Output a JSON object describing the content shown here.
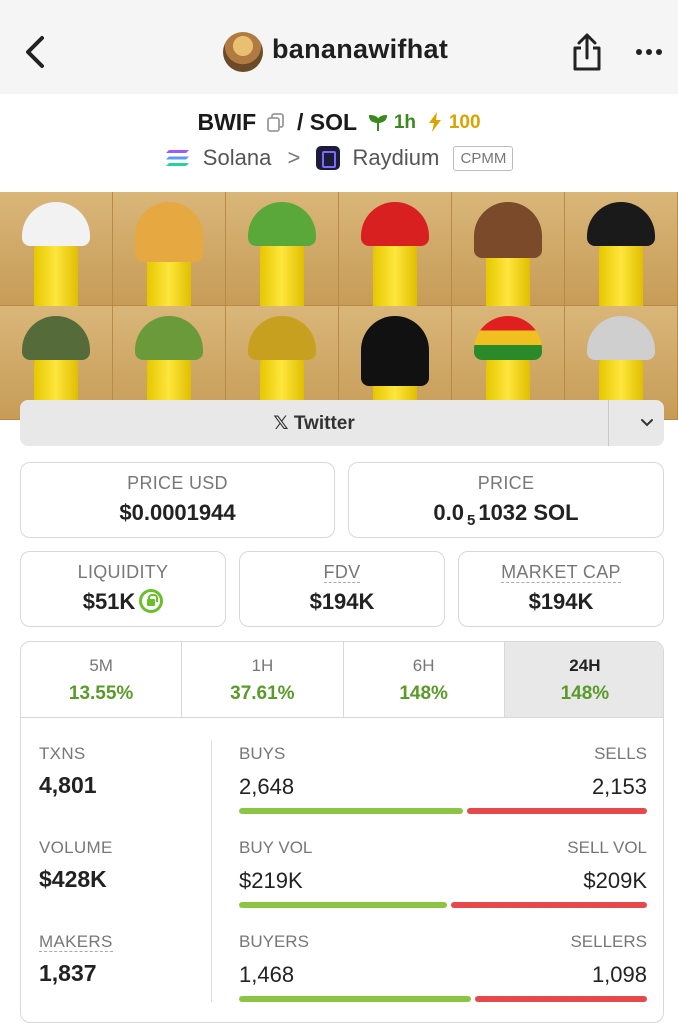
{
  "header": {
    "title": "bananawifhat",
    "back_icon": "chevron-left-icon",
    "share_icon": "share-icon",
    "more_icon": "more-icon"
  },
  "pair": {
    "base": "BWIF",
    "separator": "/",
    "quote": "SOL",
    "age": "1h",
    "boost": "100"
  },
  "chain": {
    "network": "Solana",
    "arrow": ">",
    "dex": "Raydium",
    "pool_type": "CPMM"
  },
  "social": {
    "label": "Twitter",
    "icon": "x-icon"
  },
  "stats": {
    "price_usd_label": "PRICE USD",
    "price_usd": "$0.0001944",
    "price_label": "PRICE",
    "price_prefix": "0.0",
    "price_sub": "5",
    "price_rest": "1032 SOL",
    "liquidity_label": "LIQUIDITY",
    "liquidity": "$51K",
    "fdv_label": "FDV",
    "fdv": "$194K",
    "mcap_label": "MARKET CAP",
    "mcap": "$194K"
  },
  "tabs": [
    {
      "label": "5M",
      "value": "13.55%"
    },
    {
      "label": "1H",
      "value": "37.61%"
    },
    {
      "label": "6H",
      "value": "148%"
    },
    {
      "label": "24H",
      "value": "148%"
    }
  ],
  "details": {
    "txns_label": "TXNS",
    "txns": "4,801",
    "volume_label": "VOLUME",
    "volume": "$428K",
    "makers_label": "MAKERS",
    "makers": "1,837",
    "buys_label": "BUYS",
    "buys": "2,648",
    "sells_label": "SELLS",
    "sells": "2,153",
    "buyvol_label": "BUY VOL",
    "buyvol": "$219K",
    "sellvol_label": "SELL VOL",
    "sellvol": "$209K",
    "buyers_label": "BUYERS",
    "buyers": "1,468",
    "sellers_label": "SELLERS",
    "sellers": "1,098"
  },
  "colors": {
    "positive": "#5a9a2a",
    "buy_bar": "#8cc444",
    "sell_bar": "#e5494b",
    "boost": "#d9a400"
  }
}
